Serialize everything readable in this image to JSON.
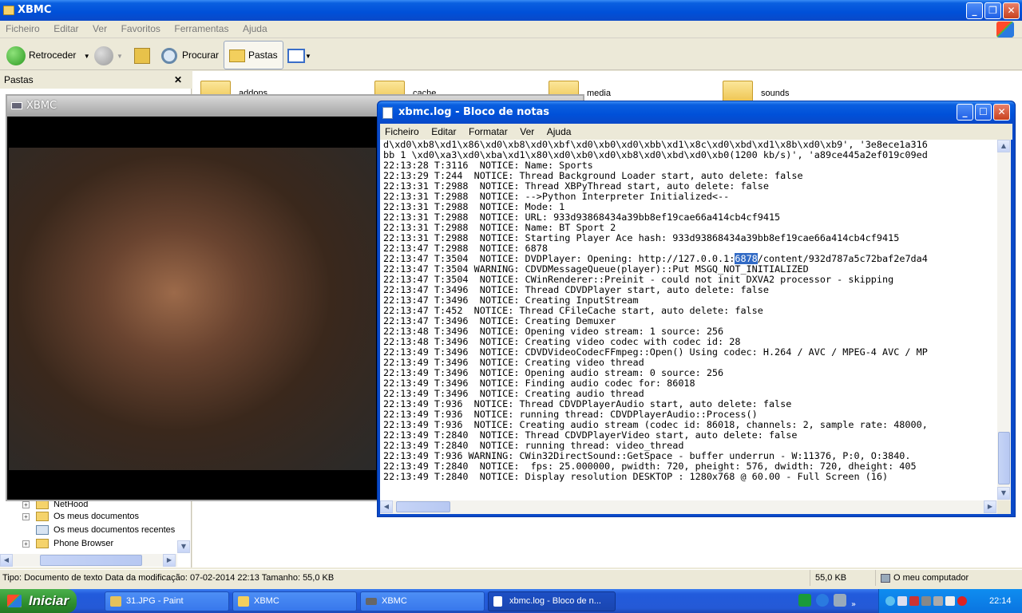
{
  "explorer": {
    "title": "XBMC",
    "menu": [
      "Ficheiro",
      "Editar",
      "Ver",
      "Favoritos",
      "Ferramentas",
      "Ajuda"
    ],
    "toolbar": {
      "back": "Retroceder",
      "search": "Procurar",
      "folders": "Pastas"
    },
    "pane_header": "Pastas",
    "pane_close": "✕",
    "folders": [
      "addons",
      "cache",
      "media",
      "sounds"
    ],
    "tree": [
      "NetHood",
      "Os meus documentos",
      "Os meus documentos recentes",
      "Phone Browser"
    ],
    "status": {
      "info": "Tipo: Documento de texto Data da modificação: 07-02-2014 22:13 Tamanho: 55,0 KB",
      "size": "55,0 KB",
      "location": "O meu computador"
    }
  },
  "xbmc_window": {
    "title": "XBMC"
  },
  "notepad": {
    "title": "xbmc.log - Bloco de notas",
    "menu": [
      "Ficheiro",
      "Editar",
      "Formatar",
      "Ver",
      "Ajuda"
    ],
    "lines": [
      "d\\xd0\\xb8\\xd1\\x86\\xd0\\xb8\\xd0\\xbf\\xd0\\xb0\\xd0\\xbb\\xd1\\x8c\\xd0\\xbd\\xd1\\x8b\\xd0\\xb9', '3e8ece1a316",
      "bb 1 \\xd0\\xa3\\xd0\\xba\\xd1\\x80\\xd0\\xb0\\xd0\\xb8\\xd0\\xbd\\xd0\\xb0(1200 kb/s)', 'a89ce445a2ef019c09ed",
      "22:13:28 T:3116  NOTICE: Name: Sports",
      "22:13:29 T:244  NOTICE: Thread Background Loader start, auto delete: false",
      "22:13:31 T:2988  NOTICE: Thread XBPyThread start, auto delete: false",
      "22:13:31 T:2988  NOTICE: -->Python Interpreter Initialized<--",
      "22:13:31 T:2988  NOTICE: Mode: 1",
      "22:13:31 T:2988  NOTICE: URL: 933d93868434a39bb8ef19cae66a414cb4cf9415",
      "22:13:31 T:2988  NOTICE: Name: BT Sport 2",
      "22:13:31 T:2988  NOTICE: Starting Player Ace hash: 933d93868434a39bb8ef19cae66a414cb4cf9415",
      "22:13:47 T:2988  NOTICE: 6878",
      "22:13:47 T:3504  NOTICE: DVDPlayer: Opening: http://127.0.0.1:",
      "22:13:47 T:3504 WARNING: CDVDMessageQueue(player)::Put MSGQ_NOT_INITIALIZED",
      "22:13:47 T:3504  NOTICE: CWinRenderer::Preinit - could not init DXVA2 processor - skipping",
      "22:13:47 T:3496  NOTICE: Thread CDVDPlayer start, auto delete: false",
      "22:13:47 T:3496  NOTICE: Creating InputStream",
      "22:13:47 T:452  NOTICE: Thread CFileCache start, auto delete: false",
      "22:13:47 T:3496  NOTICE: Creating Demuxer",
      "22:13:48 T:3496  NOTICE: Opening video stream: 1 source: 256",
      "22:13:48 T:3496  NOTICE: Creating video codec with codec id: 28",
      "22:13:49 T:3496  NOTICE: CDVDVideoCodecFFmpeg::Open() Using codec: H.264 / AVC / MPEG-4 AVC / MP",
      "22:13:49 T:3496  NOTICE: Creating video thread",
      "22:13:49 T:3496  NOTICE: Opening audio stream: 0 source: 256",
      "22:13:49 T:3496  NOTICE: Finding audio codec for: 86018",
      "22:13:49 T:3496  NOTICE: Creating audio thread",
      "22:13:49 T:936  NOTICE: Thread CDVDPlayerAudio start, auto delete: false",
      "22:13:49 T:936  NOTICE: running thread: CDVDPlayerAudio::Process()",
      "22:13:49 T:936  NOTICE: Creating audio stream (codec id: 86018, channels: 2, sample rate: 48000,",
      "22:13:49 T:2840  NOTICE: Thread CDVDPlayerVideo start, auto delete: false",
      "22:13:49 T:2840  NOTICE: running thread: video_thread",
      "22:13:49 T:936 WARNING: CWin32DirectSound::GetSpace - buffer underrun - W:11376, P:0, O:3840.",
      "22:13:49 T:2840  NOTICE:  fps: 25.000000, pwidth: 720, pheight: 576, dwidth: 720, dheight: 405",
      "22:13:49 T:2840  NOTICE: Display resolution DESKTOP : 1280x768 @ 60.00 - Full Screen (16)"
    ],
    "highlight_selected": "6878",
    "highlight_after": "/content/932d787a5c72baf2e7da4"
  },
  "taskbar": {
    "start": "Iniciar",
    "tasks": [
      "31.JPG - Paint",
      "XBMC",
      "XBMC",
      "xbmc.log - Bloco de n..."
    ],
    "clock": "22:14"
  }
}
